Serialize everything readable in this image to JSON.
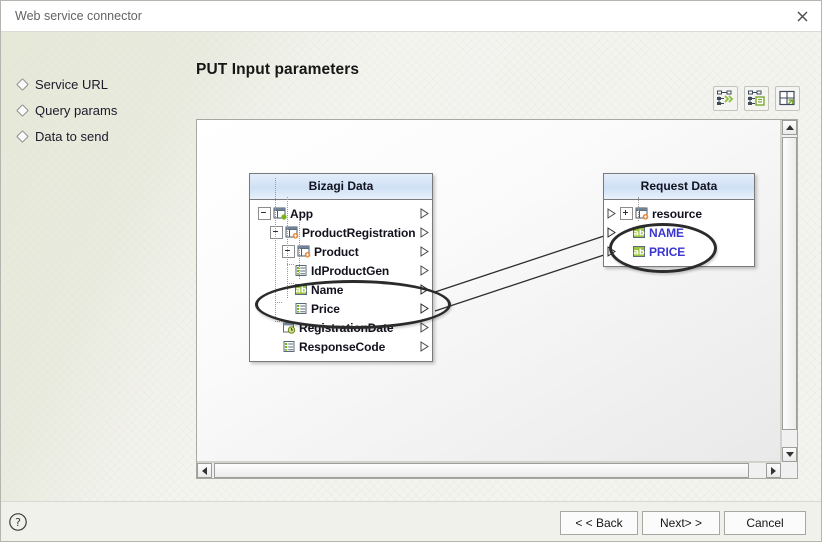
{
  "window": {
    "title": "Web service connector",
    "close_icon": "close-icon"
  },
  "sidebar": {
    "items": [
      {
        "label": "Service URL"
      },
      {
        "label": "Query params"
      },
      {
        "label": "Data to send"
      }
    ]
  },
  "header": {
    "page_title": "PUT Input parameters"
  },
  "toolbar": {
    "buttons": [
      {
        "name": "auto-map-button",
        "icon": "auto-map-icon",
        "tooltip": "Auto map"
      },
      {
        "name": "map-properties-button",
        "icon": "map-properties-icon",
        "tooltip": "Mapping properties"
      },
      {
        "name": "expand-layout-button",
        "icon": "expand-layout-icon",
        "tooltip": "Arrange"
      }
    ]
  },
  "canvas": {
    "source_panel": {
      "title": "Bizagi Data",
      "nodes": [
        {
          "label": "App",
          "depth": 0,
          "icon": "entity-root-icon",
          "expander": "minus",
          "port": "right"
        },
        {
          "label": "ProductRegistration",
          "depth": 1,
          "icon": "entity-icon",
          "expander": "minus",
          "port": "right"
        },
        {
          "label": "Product",
          "depth": 2,
          "icon": "entity-icon",
          "expander": "minus",
          "port": "right"
        },
        {
          "label": "IdProductGen",
          "depth": 3,
          "icon": "list-attribute-icon",
          "expander": "none",
          "port": "right"
        },
        {
          "label": "Name",
          "depth": 3,
          "icon": "text-attribute-icon",
          "expander": "none",
          "port": "right"
        },
        {
          "label": "Price",
          "depth": 3,
          "icon": "list-attribute-icon",
          "expander": "none",
          "port": "right"
        },
        {
          "label": "RegistrationDate",
          "depth": 2,
          "icon": "date-attribute-icon",
          "expander": "none",
          "port": "right"
        },
        {
          "label": "ResponseCode",
          "depth": 2,
          "icon": "list-attribute-icon",
          "expander": "none",
          "port": "right"
        }
      ]
    },
    "target_panel": {
      "title": "Request Data",
      "nodes": [
        {
          "label": "resource",
          "depth": 0,
          "icon": "entity-icon",
          "expander": "plus",
          "port": "left",
          "highlighted": false
        },
        {
          "label": "NAME",
          "depth": 1,
          "icon": "text-attribute-icon",
          "expander": "none",
          "port": "left",
          "highlighted": true
        },
        {
          "label": "PRICE",
          "depth": 1,
          "icon": "text-attribute-icon",
          "expander": "none",
          "port": "left",
          "highlighted": true
        }
      ]
    },
    "mappings": [
      {
        "from": "Name",
        "to": "NAME"
      },
      {
        "from": "Price",
        "to": "PRICE"
      }
    ],
    "highlights": [
      {
        "name": "source-selection-ellipse",
        "targets": [
          "Name",
          "Price"
        ]
      },
      {
        "name": "target-selection-ellipse",
        "targets": [
          "NAME",
          "PRICE"
        ]
      }
    ],
    "scrollbars": {
      "vertical": {
        "up_icon": "caret-up-icon",
        "down_icon": "caret-down-icon"
      },
      "horizontal": {
        "left_icon": "caret-left-icon",
        "right_icon": "caret-right-icon"
      }
    }
  },
  "footer": {
    "help_icon": "help-icon",
    "back_label": "< < Back",
    "next_label": "Next> >",
    "cancel_label": "Cancel"
  },
  "colors": {
    "accent_blue": "#3b36d0",
    "panel_header": "#cfe0f5",
    "icon_green": "#8fbf3f",
    "icon_orange": "#e2893a",
    "background": "#f3f3ef"
  }
}
